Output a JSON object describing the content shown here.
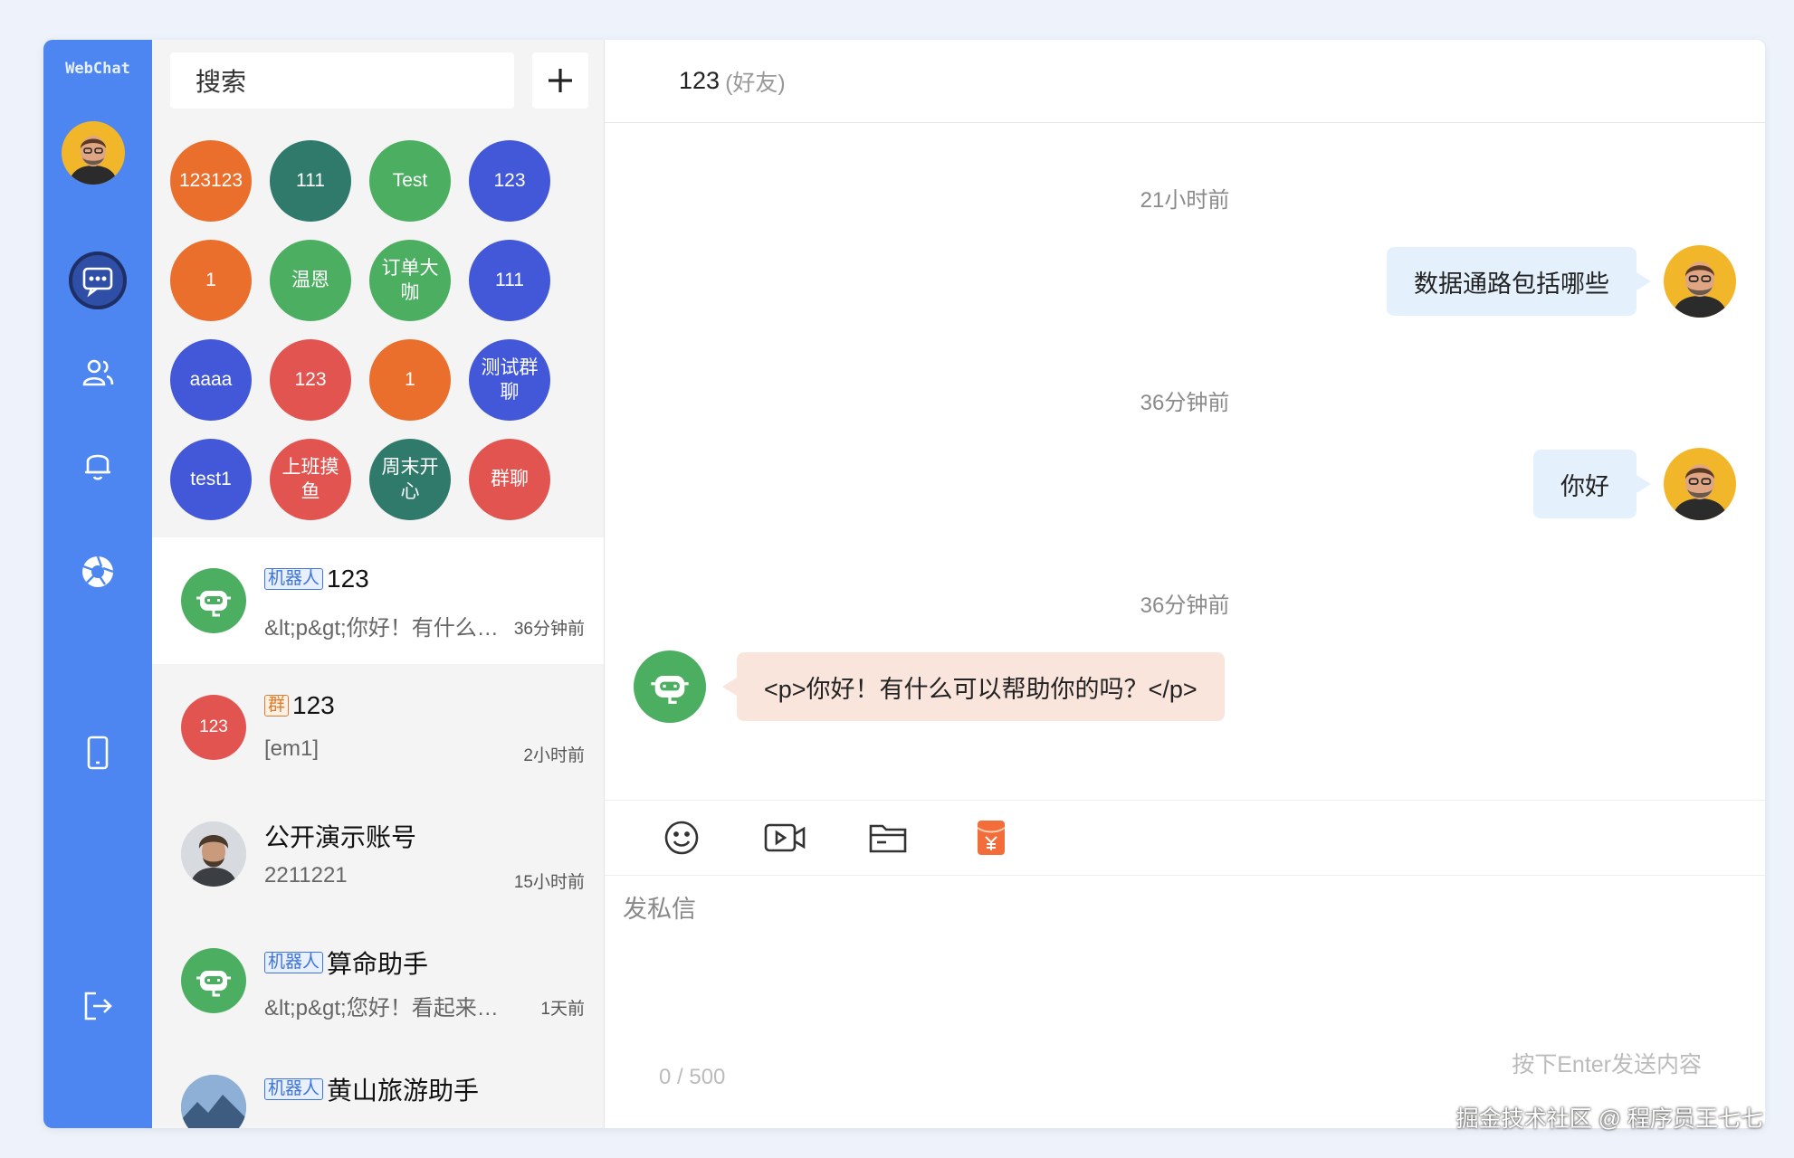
{
  "sidebar": {
    "brand": "WebChat",
    "accent": "#4d86f0",
    "nav": [
      "chat-icon",
      "contacts-icon",
      "bell-icon",
      "aperture-icon",
      "mobile-icon",
      "logout-icon"
    ]
  },
  "contacts": {
    "search_placeholder": "搜索",
    "add_label": "+",
    "groups": [
      {
        "label": "123123",
        "color": "#ea6f2d"
      },
      {
        "label": "111",
        "color": "#2f7a6a"
      },
      {
        "label": "Test",
        "color": "#4cae60"
      },
      {
        "label": "123",
        "color": "#4258d8"
      },
      {
        "label": "1",
        "color": "#ea6f2d"
      },
      {
        "label": "温恩",
        "color": "#4cae60"
      },
      {
        "label": "订单大咖",
        "color": "#4cae60"
      },
      {
        "label": "111",
        "color": "#4258d8"
      },
      {
        "label": "aaaa",
        "color": "#4258d8"
      },
      {
        "label": "123",
        "color": "#e25450"
      },
      {
        "label": "1",
        "color": "#ea6f2d"
      },
      {
        "label": "测试群聊",
        "color": "#4258d8"
      },
      {
        "label": "test1",
        "color": "#4258d8"
      },
      {
        "label": "上班摸鱼",
        "color": "#e25450"
      },
      {
        "label": "周末开心",
        "color": "#2f7a6a"
      },
      {
        "label": "群聊",
        "color": "#e25450"
      }
    ],
    "chats": [
      {
        "tag": "机器人",
        "name": "123",
        "message": "&lt;p&gt;你好！有什么可以帮助你的吗？",
        "time": "36分钟前"
      },
      {
        "tag": "群",
        "name": "123",
        "avatar_text": "123",
        "message": "[em1]",
        "time": "2小时前"
      },
      {
        "tag": "",
        "name": "公开演示账号",
        "message": "2211221",
        "time": "15小时前"
      },
      {
        "tag": "机器人",
        "name": "算命助手",
        "message": "&lt;p&gt;您好！看起来您可能",
        "time": "1天前"
      },
      {
        "tag": "机器人",
        "name": "黄山旅游助手",
        "message": "",
        "time": ""
      }
    ]
  },
  "chat": {
    "title": "123",
    "subtitle": "(好友)",
    "messages": [
      {
        "timestamp": "21小时前",
        "from": "me",
        "text": "数据通路包括哪些"
      },
      {
        "timestamp": "36分钟前",
        "from": "me",
        "text": "你好"
      },
      {
        "timestamp": "36分钟前",
        "from": "bot",
        "text": "<p>你好！有什么可以帮助你的吗？</p>"
      }
    ],
    "toolbar": [
      "smile-icon",
      "video-icon",
      "folder-icon",
      "red-envelope-icon"
    ],
    "input_placeholder": "发私信",
    "counter": "0 / 500",
    "hint": "按下Enter发送内容"
  },
  "watermark": "掘金技术社区 @ 程序员王七七"
}
